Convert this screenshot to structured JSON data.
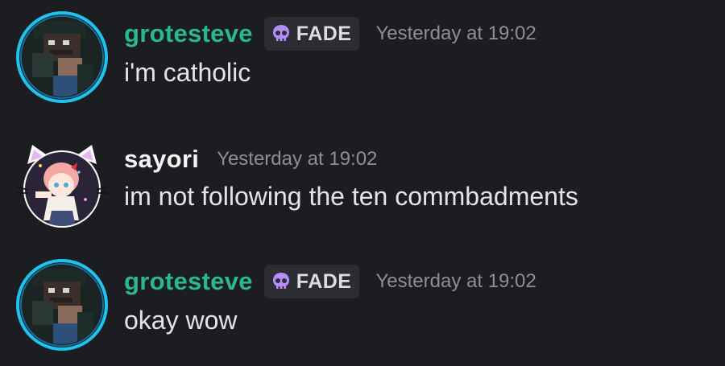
{
  "messages": [
    {
      "username": "grotesteve",
      "tag": "FADE",
      "timestamp": "Yesterday at 19:02",
      "text": "i'm catholic"
    },
    {
      "username": "sayori",
      "timestamp": "Yesterday at 19:02",
      "text": "im not following the ten commbadments"
    },
    {
      "username": "grotesteve",
      "tag": "FADE",
      "timestamp": "Yesterday at 19:02",
      "text": "okay wow"
    }
  ],
  "colors": {
    "background": "#1c1d21",
    "username_green": "#29b98a",
    "username_white": "#f2f3f5",
    "tag_bg": "#2b2d33",
    "tag_icon": "#b58cff",
    "timestamp": "#8d8f97",
    "message_text": "#e3e4e7",
    "avatar_ring": "#1ec3f0"
  },
  "icons": {
    "tag_icon": "skull-icon",
    "avatar_1": "minecraft-avatar",
    "avatar_2": "anime-cat-ears-avatar"
  }
}
